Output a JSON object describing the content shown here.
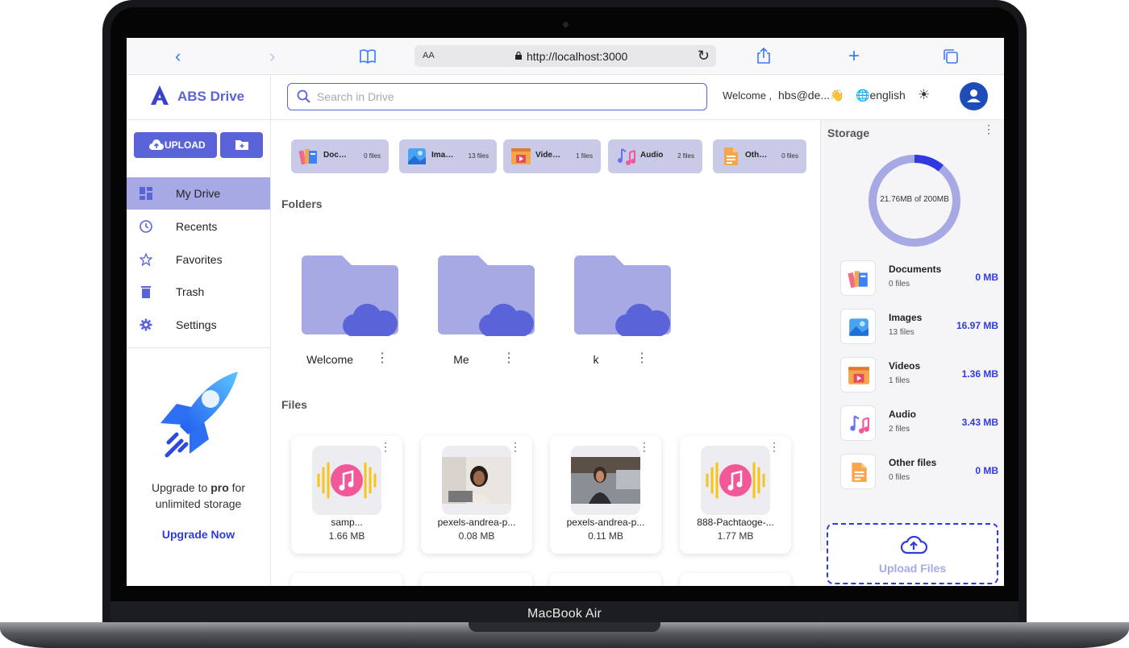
{
  "device": {
    "label": "MacBook Air"
  },
  "browser": {
    "aa": "AA",
    "url": "http://localhost:3000"
  },
  "app": {
    "name": "ABS Drive",
    "search_placeholder": "Search in Drive",
    "welcome": "Welcome ,",
    "user": "hbs@de...👋",
    "language": "english",
    "upload_label": "UPLOAD",
    "accent": "#5a63d8",
    "link_color": "#2f3ae0"
  },
  "sidebar": {
    "items": [
      {
        "label": "My Drive",
        "icon": "dashboard-icon"
      },
      {
        "label": "Recents",
        "icon": "clock-icon"
      },
      {
        "label": "Favorites",
        "icon": "star-icon"
      },
      {
        "label": "Trash",
        "icon": "trash-icon"
      },
      {
        "label": "Settings",
        "icon": "gear-icon"
      }
    ],
    "promo_line1_a": "Upgrade to ",
    "promo_line1_b": "pro",
    "promo_line1_c": " for",
    "promo_line2": "unlimited storage",
    "upgrade_link": "Upgrade Now"
  },
  "categories": [
    {
      "label": "Documents",
      "count": "0 files",
      "icon": "documents-icon"
    },
    {
      "label": "Images",
      "count": "13 files",
      "icon": "images-icon"
    },
    {
      "label": "Videos",
      "count": "1 files",
      "icon": "videos-icon"
    },
    {
      "label": "Audio",
      "count": "2 files",
      "icon": "audio-icon"
    },
    {
      "label": "Other files",
      "count": "0 files",
      "icon": "other-files-icon"
    }
  ],
  "sections": {
    "folders": "Folders",
    "files": "Files"
  },
  "folders": [
    {
      "name": "Welcome"
    },
    {
      "name": "Me"
    },
    {
      "name": "k"
    }
  ],
  "files": [
    {
      "name": "samp...",
      "size": "1.66 MB",
      "kind": "audio"
    },
    {
      "name": "pexels-andrea-p...",
      "size": "0.08 MB",
      "kind": "image"
    },
    {
      "name": "pexels-andrea-p...",
      "size": "0.11 MB",
      "kind": "image"
    },
    {
      "name": "888-Pachtaoge-...",
      "size": "1.77 MB",
      "kind": "audio"
    }
  ],
  "storage": {
    "title": "Storage",
    "used_label": "21.76MB of 200MB",
    "used_mb": 21.76,
    "total_mb": 200,
    "rows": [
      {
        "name": "Documents",
        "count": "0 files",
        "size": "0 MB"
      },
      {
        "name": "Images",
        "count": "13 files",
        "size": "16.97 MB"
      },
      {
        "name": "Videos",
        "count": "1 files",
        "size": "1.36 MB"
      },
      {
        "name": "Audio",
        "count": "2 files",
        "size": "3.43 MB"
      },
      {
        "name": "Other files",
        "count": "0 files",
        "size": "0 MB"
      }
    ],
    "upload_files": "Upload Files"
  }
}
